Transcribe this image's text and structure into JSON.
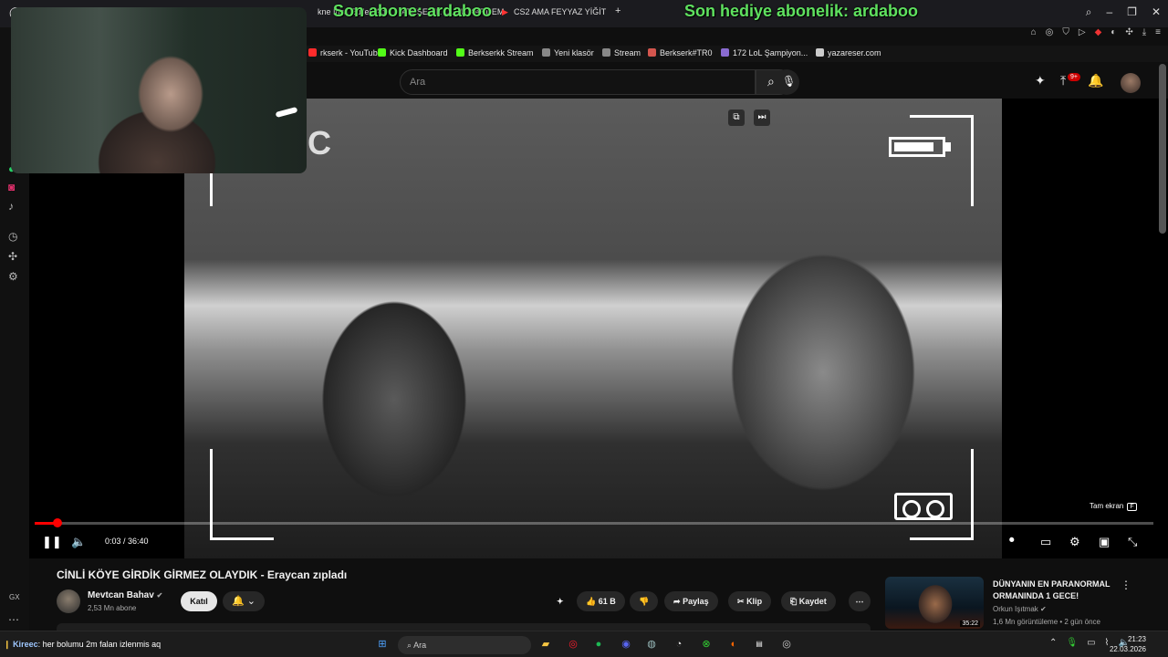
{
  "browser": {
    "tabs": [
      "kne İnşa Edilen Ad",
      "ATEŞE NE OLDU KARDEM",
      "CS2 AMA FEYYAZ YİĞİT"
    ],
    "new_tab": "+",
    "bookmarks": [
      {
        "label": "rkserk - YouTube",
        "color": "#ff2b2b"
      },
      {
        "label": "Kick Dashboard",
        "color": "#53fc18"
      },
      {
        "label": "Berkserkk Stream",
        "color": "#53fc18"
      },
      {
        "label": "Yeni klasör",
        "color": "#888888"
      },
      {
        "label": "Stream",
        "color": "#888888"
      },
      {
        "label": "Berkserk#TR0",
        "color": "#d4564e"
      },
      {
        "label": "172 LoL Şampiyon...",
        "color": "#8a6bd1"
      },
      {
        "label": "yazareser.com",
        "color": "#cccccc"
      }
    ]
  },
  "alerts": {
    "subscriber": "Son abone: ardaboo",
    "gift": "Son hediye abonelik: ardaboo"
  },
  "youtube": {
    "search_placeholder": "Ara",
    "notification_badge": "9+"
  },
  "player": {
    "time": "0:03 / 36:40",
    "progress": 0.0014,
    "fullscreen_tip": "Tam ekran",
    "fullscreen_key": "F",
    "battery_level": 0.85
  },
  "video": {
    "title": "CİNLİ KÖYE GİRDİK GİRMEZ OLAYDIK - Eraycan zıpladı",
    "channel": "Mevtcan Bahav",
    "subscribers": "2,53 Mn abone",
    "join": "Katıl",
    "likes": "61 B",
    "share": "Paylaş",
    "clip": "Klip",
    "save": "Kaydet"
  },
  "recommended": {
    "title": "DÜNYANIN EN PARANORMAL ORMANINDA 1 GECE!",
    "channel": "Orkun Işıtmak",
    "meta": "1,6 Mn görüntüleme • 2 gün önce",
    "duration": "35:22"
  },
  "taskbar": {
    "chat_user": "Kireec",
    "chat_message": ": her bolumu 2m falan izlenmis aq",
    "search": "Ara",
    "time": "21:23",
    "date": "22.03.2026"
  },
  "sidebar_label": "GX"
}
